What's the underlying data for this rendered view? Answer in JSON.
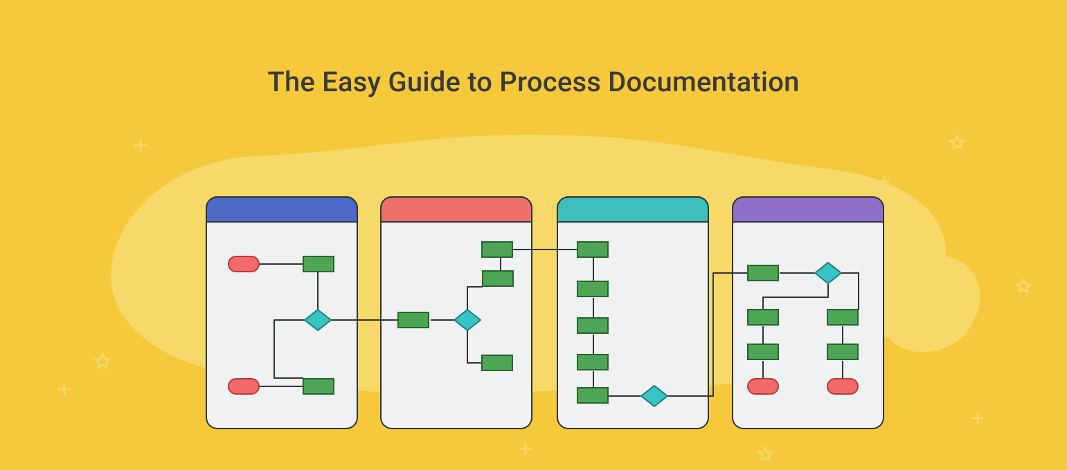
{
  "title": "The Easy Guide to Process Documentation",
  "colors": {
    "background": "#F5C93B",
    "blob": "#F7D969",
    "cardBody": "#F0F1F2",
    "cardStroke": "#2E3436",
    "headerBlue": "#4D6BC6",
    "headerRed": "#EF6F6A",
    "headerTeal": "#3EBFBF",
    "headerPurple": "#8E6FC7",
    "process": "#4FA556",
    "processStroke": "#24662B",
    "terminator": "#F26A6A",
    "terminatorStroke": "#B83A3A",
    "decision": "#36C4C4",
    "decisionStroke": "#1E7D7D",
    "connector": "#2E3436"
  },
  "cards": [
    {
      "id": "card-1",
      "headerColor": "headerBlue"
    },
    {
      "id": "card-2",
      "headerColor": "headerRed"
    },
    {
      "id": "card-3",
      "headerColor": "headerTeal"
    },
    {
      "id": "card-4",
      "headerColor": "headerPurple"
    }
  ]
}
